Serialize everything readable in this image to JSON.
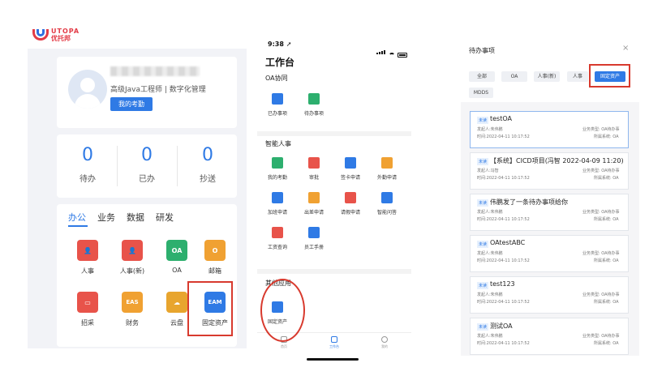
{
  "logo": {
    "en": "UTOPA",
    "cn": "优托邦"
  },
  "portal": {
    "profile": {
      "job_title": "高级Java工程师 | 数字化管理",
      "attendance_button": "我的考勤"
    },
    "counts": [
      {
        "value": "0",
        "label": "待办"
      },
      {
        "value": "0",
        "label": "已办"
      },
      {
        "value": "0",
        "label": "抄送"
      }
    ],
    "tabs": [
      "办公",
      "业务",
      "数据",
      "研发"
    ],
    "apps": [
      {
        "label": "人事",
        "icon": "person-icon",
        "glyph": "👤",
        "color": "#e8534a"
      },
      {
        "label": "人事(新)",
        "icon": "person-card-icon",
        "glyph": "👤",
        "color": "#e8534a"
      },
      {
        "label": "OA",
        "icon": "oa-icon",
        "glyph": "OA",
        "color": "#2daf6e"
      },
      {
        "label": "邮箱",
        "icon": "mail-icon",
        "glyph": "O",
        "color": "#f0a132"
      },
      {
        "label": "招采",
        "icon": "bag-icon",
        "glyph": "▭",
        "color": "#e8534a"
      },
      {
        "label": "财务",
        "icon": "eas-icon",
        "glyph": "EAS",
        "color": "#f0a132"
      },
      {
        "label": "云盘",
        "icon": "cloud-icon",
        "glyph": "☁",
        "color": "#e8a52e"
      },
      {
        "label": "固定资产",
        "icon": "eam-icon",
        "glyph": "EAM",
        "color": "#2f7ae5"
      }
    ]
  },
  "mobile": {
    "time": "9:38",
    "title": "工作台",
    "sections": [
      {
        "title": "OA协同",
        "items": [
          {
            "label": "已办事项",
            "icon": "clipboard-check-icon",
            "color": "#2f7ae5"
          },
          {
            "label": "待办事项",
            "icon": "clipboard-list-icon",
            "color": "#2daf6e"
          }
        ]
      },
      {
        "title": "智能人事",
        "items": [
          {
            "label": "我的考勤",
            "icon": "check-circle-icon",
            "color": "#2daf6e"
          },
          {
            "label": "审批",
            "icon": "stamp-icon",
            "color": "#e8534a"
          },
          {
            "label": "签卡申请",
            "icon": "plus-doc-icon",
            "color": "#2f7ae5"
          },
          {
            "label": "外勤申请",
            "icon": "briefcase-icon",
            "color": "#f0a132"
          },
          {
            "label": "加班申请",
            "icon": "clock-icon",
            "color": "#2f7ae5"
          },
          {
            "label": "出差申请",
            "icon": "plane-icon",
            "color": "#f0a132"
          },
          {
            "label": "请假申请",
            "icon": "leave-doc-icon",
            "color": "#e8534a"
          },
          {
            "label": "智能问答",
            "icon": "robot-icon",
            "color": "#2f7ae5"
          },
          {
            "label": "工资查询",
            "icon": "yen-icon",
            "color": "#e8534a"
          },
          {
            "label": "员工手册",
            "icon": "book-icon",
            "color": "#2f7ae5"
          }
        ]
      },
      {
        "title": "其他应用",
        "items": [
          {
            "label": "固定资产",
            "icon": "asset-icon",
            "color": "#2f7ae5"
          }
        ]
      }
    ],
    "tabbar": [
      "首页",
      "工作台",
      "我的"
    ]
  },
  "todo": {
    "title": "待办事项",
    "close": "×",
    "filters": [
      "全部",
      "OA",
      "人事(新)",
      "人事",
      "固定资产",
      "MDDS"
    ],
    "active_filter": 4,
    "items": [
      {
        "tag": "未读",
        "name": "testOA",
        "sender": "发起人:朱伟鹏",
        "time": "时间:2022-04-11 10:17:52",
        "type": "业务类型: OA待办事",
        "system": "所属系统: OA"
      },
      {
        "tag": "未读",
        "name": "【系统】CICD项目(冯智 2022-04-09 11:20)",
        "sender": "发起人:冯智",
        "time": "时间:2022-04-11 10:17:52",
        "type": "业务类型: OA待办事",
        "system": "所属系统: OA"
      },
      {
        "tag": "未读",
        "name": "伟鹏发了一条待办事项给你",
        "sender": "发起人:朱伟鹏",
        "time": "时间:2022-04-11 10:17:52",
        "type": "业务类型: OA待办事",
        "system": "所属系统: OA"
      },
      {
        "tag": "未读",
        "name": "OAtestABC",
        "sender": "发起人:朱伟鹏",
        "time": "时间:2022-04-11 10:17:52",
        "type": "业务类型: OA待办事",
        "system": "所属系统: OA"
      },
      {
        "tag": "未读",
        "name": "test123",
        "sender": "发起人:朱伟鹏",
        "time": "时间:2022-04-11 10:17:52",
        "type": "业务类型: OA待办事",
        "system": "所属系统: OA"
      },
      {
        "tag": "未读",
        "name": "测试OA",
        "sender": "发起人:朱伟鹏",
        "time": "时间:2022-04-11 10:17:52",
        "type": "业务类型: OA待办事",
        "system": "所属系统: OA"
      }
    ]
  }
}
